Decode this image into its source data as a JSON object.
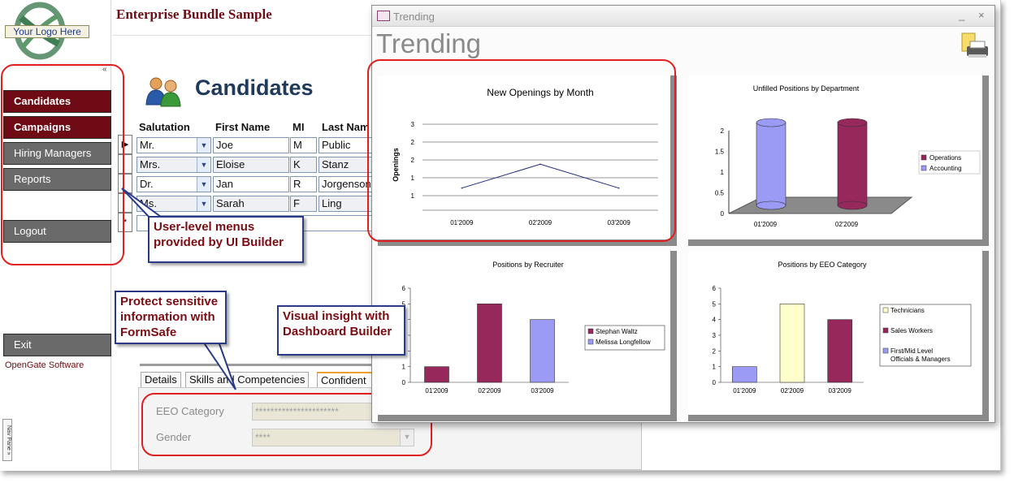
{
  "app": {
    "title": "Enterprise Bundle Sample",
    "logo_text": "Your Logo Here",
    "collapse_glyph": "«",
    "menu": [
      {
        "label": "Candidates",
        "style": "dark"
      },
      {
        "label": "Campaigns",
        "style": "dark"
      },
      {
        "label": "Hiring Managers",
        "style": "grey"
      },
      {
        "label": "Reports",
        "style": "grey"
      },
      {
        "label": "Logout",
        "style": "grey"
      },
      {
        "label": "Exit",
        "style": "grey"
      }
    ],
    "company": "OpenGate Software",
    "nav_pane": "Nav Pane »"
  },
  "form": {
    "title": "Candidates",
    "columns": [
      "Salutation",
      "First Name",
      "MI",
      "Last Nam"
    ],
    "rows": [
      {
        "salutation": "Mr.",
        "first": "Joe",
        "mi": "M",
        "last": "Public"
      },
      {
        "salutation": "Mrs.",
        "first": "Eloise",
        "mi": "K",
        "last": "Stanz"
      },
      {
        "salutation": "Dr.",
        "first": "Jan",
        "mi": "R",
        "last": "Jorgenson"
      },
      {
        "salutation": "Ms.",
        "first": "Sarah",
        "mi": "F",
        "last": "Ling"
      }
    ],
    "new_row_marker": "*",
    "current_row_marker": "▶",
    "tabs": [
      "Details",
      "Skills and Competencies",
      "Confident"
    ],
    "fields": [
      {
        "label": "EEO Category",
        "value": "**********************"
      },
      {
        "label": "Gender",
        "value": "****"
      }
    ]
  },
  "callouts": {
    "menus": "User-level menus provided by UI Builder",
    "formsafe": "Protect sensitive information with FormSafe",
    "dashboard": "Visual insight with Dashboard Builder"
  },
  "trending": {
    "window_title": "Trending",
    "heading": "Trending",
    "min_glyph": "_",
    "close_glyph": "×"
  },
  "colors": {
    "menu_dark": "#6e0b14",
    "menu_grey": "#6a6a6a",
    "callout_border": "#2b3a88",
    "callout_text": "#7a0c12",
    "highlight": "#e02020"
  },
  "chart_data": [
    {
      "type": "line",
      "title": "New Openings by Month",
      "ylabel": "Openings",
      "categories": [
        "01'2009",
        "02'2009",
        "03'2009"
      ],
      "yticks": [
        "1",
        "1",
        "2",
        "2",
        "3"
      ],
      "series": [
        {
          "values": [
            1,
            2,
            1
          ]
        }
      ],
      "ylim": [
        0,
        3
      ],
      "grid": true
    },
    {
      "type": "bar",
      "title": "Unfilled Positions by Department",
      "categories": [
        "01'2009",
        "02'2009"
      ],
      "yticks": [
        "0",
        "0.5",
        "1",
        "1.5",
        "2"
      ],
      "series": [
        {
          "name": "Accounting",
          "values": [
            2,
            0
          ]
        },
        {
          "name": "Operations",
          "values": [
            0,
            2
          ]
        }
      ],
      "ylim": [
        0,
        2
      ],
      "legend": "right"
    },
    {
      "type": "bar",
      "title": "Positions by Recruiter",
      "categories": [
        "01'2009",
        "02'2009",
        "03'2009"
      ],
      "yticks": [
        "0",
        "1",
        "2",
        "3",
        "4",
        "5",
        "6"
      ],
      "series": [
        {
          "name": "Stephan Waltz",
          "values": [
            1,
            5,
            0
          ]
        },
        {
          "name": "Melissa Longfellow",
          "values": [
            0,
            0,
            4
          ]
        }
      ],
      "ylim": [
        0,
        6
      ],
      "legend": "right"
    },
    {
      "type": "bar",
      "title": "Positions by EEO Category",
      "categories": [
        "01'2009",
        "02'2009",
        "03'2009"
      ],
      "yticks": [
        "0",
        "1",
        "2",
        "3",
        "4",
        "5",
        "6"
      ],
      "series": [
        {
          "name": "Technicians",
          "values": [
            0,
            5,
            0
          ]
        },
        {
          "name": "Sales Workers",
          "values": [
            0,
            0,
            4
          ]
        },
        {
          "name": "First/Mid Level Officials & Managers",
          "values": [
            1,
            0,
            0
          ]
        }
      ],
      "ylim": [
        0,
        6
      ],
      "legend": "right"
    }
  ]
}
